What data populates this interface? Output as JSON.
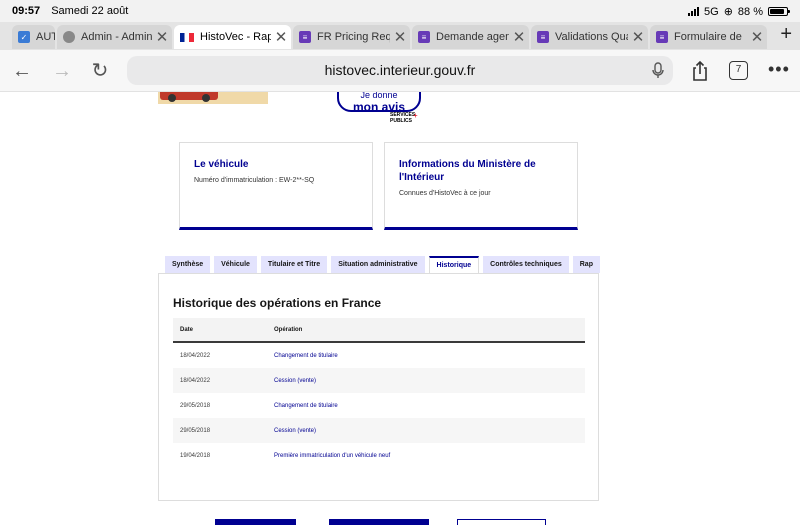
{
  "status_bar": {
    "time": "09:57",
    "date": "Samedi 22 août",
    "network": "5G",
    "battery": "88 %"
  },
  "browser_tabs": [
    {
      "label": "AUT",
      "icon": "cnil-icon"
    },
    {
      "label": "Admin - Admin",
      "icon": "globe-icon"
    },
    {
      "label": "HistoVec - Rapp",
      "icon": "french-flag-icon",
      "active": true
    },
    {
      "label": "FR Pricing Requ",
      "icon": "form-icon"
    },
    {
      "label": "Demande agen",
      "icon": "form-icon"
    },
    {
      "label": "Validations Qua",
      "icon": "form-icon"
    },
    {
      "label": "Formulaire de",
      "icon": "form-icon"
    }
  ],
  "toolbar": {
    "url": "histovec.interieur.gouv.fr",
    "tab_count": "7"
  },
  "banner": {
    "avis_line1": "Je donne",
    "avis_line2": "mon avis",
    "services_publics": "SERVICES PUBLICS"
  },
  "cards": [
    {
      "title": "Le véhicule",
      "subtitle": "Numéro d'immatriculation : EW-2**-SQ"
    },
    {
      "title": "Informations du Ministère de l'Intérieur",
      "subtitle": "Connues d'HistoVec à ce jour"
    }
  ],
  "page_tabs": [
    {
      "label": "Synthèse"
    },
    {
      "label": "Véhicule"
    },
    {
      "label": "Titulaire et Titre"
    },
    {
      "label": "Situation administrative"
    },
    {
      "label": "Historique",
      "active": true
    },
    {
      "label": "Contrôles techniques"
    },
    {
      "label": "Rap"
    }
  ],
  "history": {
    "title": "Historique des opérations en France",
    "columns": [
      "Date",
      "Opération"
    ],
    "rows": [
      {
        "date": "18/04/2022",
        "operation": "Changement de titulaire"
      },
      {
        "date": "18/04/2022",
        "operation": "Cession (vente)"
      },
      {
        "date": "29/05/2018",
        "operation": "Changement de titulaire"
      },
      {
        "date": "29/05/2018",
        "operation": "Cession (vente)"
      },
      {
        "date": "19/04/2018",
        "operation": "Première immatriculation d'un véhicule neuf"
      }
    ]
  },
  "colors": {
    "accent": "#000091",
    "tab_bg": "#e3e3fd",
    "marianne_red": "#e1000f"
  }
}
